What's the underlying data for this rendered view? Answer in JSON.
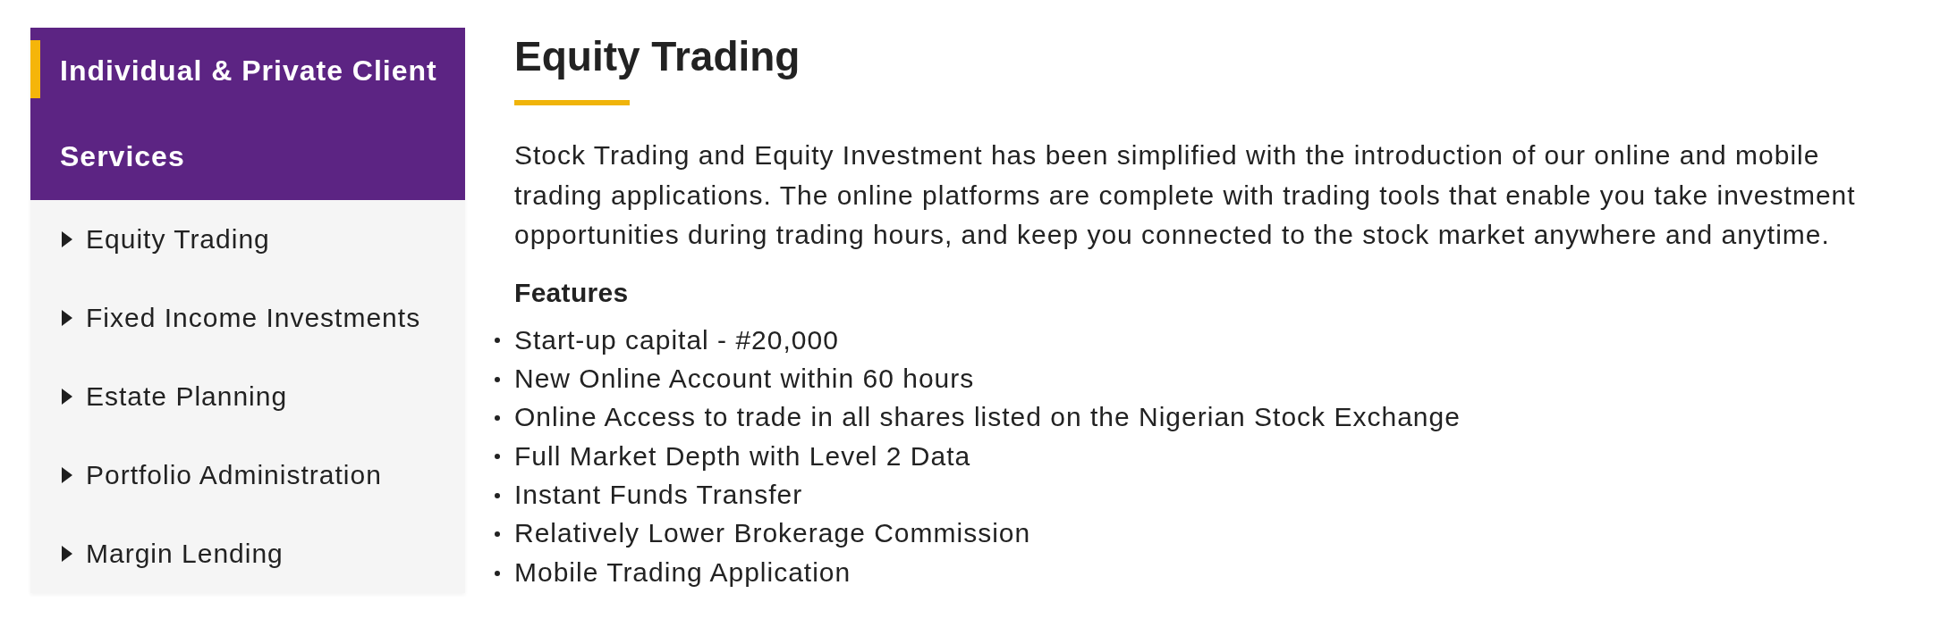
{
  "sidebar": {
    "heading": "Individual & Private Client Services",
    "items": [
      {
        "label": "Equity Trading"
      },
      {
        "label": "Fixed Income Investments"
      },
      {
        "label": "Estate Planning"
      },
      {
        "label": "Portfolio Administration"
      },
      {
        "label": "Margin Lending"
      }
    ]
  },
  "content": {
    "title": "Equity Trading",
    "intro": "Stock Trading and Equity Investment has been simplified with the introduction of our online and mobile trading applications. The online platforms are complete with trading tools that enable you take investment opportunities during trading hours, and keep you connected to the stock market anywhere and anytime.",
    "features_heading": "Features",
    "features": [
      "Start-up capital - #20,000",
      "New Online Account within 60 hours",
      "Online Access to trade in all shares listed on the Nigerian Stock Exchange",
      "Full Market Depth with Level 2 Data",
      "Instant Funds Transfer",
      "Relatively Lower Brokerage Commission",
      "Mobile Trading Application"
    ]
  }
}
